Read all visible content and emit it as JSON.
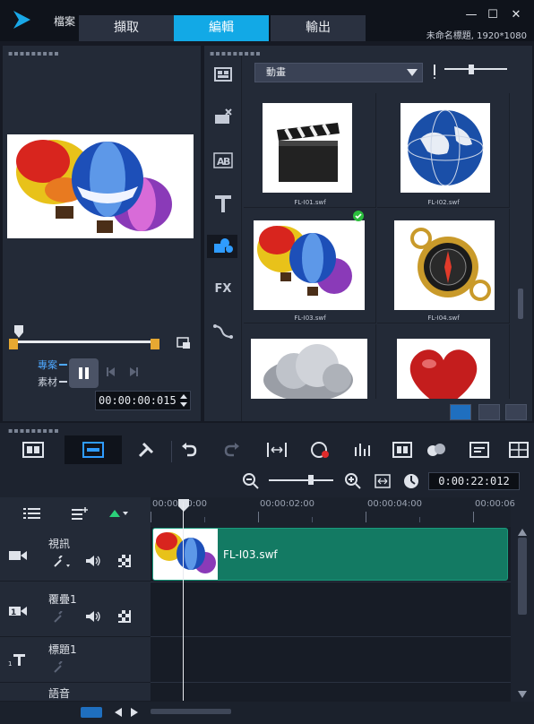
{
  "titlebar": {
    "menu_file": "檔案",
    "tabs": [
      {
        "label": "擷取"
      },
      {
        "label": "編輯"
      },
      {
        "label": "輸出"
      }
    ],
    "project_info": "未命名標題, 1920*1080",
    "window_controls": {
      "minimize": "—",
      "maximize": "☐",
      "close": "✕"
    }
  },
  "player": {
    "project_label": "專案",
    "clip_label": "素材",
    "timecode": "00:00:00:015"
  },
  "library": {
    "category": "動畫",
    "side_labels": {
      "fx": "FX"
    },
    "items": [
      {
        "caption": "FL-I01.swf",
        "kind": "clapper"
      },
      {
        "caption": "FL-I02.swf",
        "kind": "globe"
      },
      {
        "caption": "FL-I03.swf",
        "kind": "balloons",
        "selected": true
      },
      {
        "caption": "FL-I04.swf",
        "kind": "compass"
      },
      {
        "caption": "",
        "kind": "cloud"
      },
      {
        "caption": "",
        "kind": "heart"
      }
    ]
  },
  "timeline": {
    "time": "0:00:22:012",
    "ruler_ticks": [
      "00:00:00:00",
      "00:00:02:00",
      "00:00:04:00",
      "00:00:06"
    ],
    "tracks": [
      {
        "name": "視訊"
      },
      {
        "name": "覆疊1"
      },
      {
        "name": "標題1"
      },
      {
        "name": "語音"
      }
    ],
    "clip": {
      "label": "FL-I03.swf"
    }
  },
  "colors": {
    "accent": "#12a9e6",
    "clip": "#137a63",
    "marker": "#e6a832",
    "background": "#161a24",
    "panel": "#232a37"
  }
}
